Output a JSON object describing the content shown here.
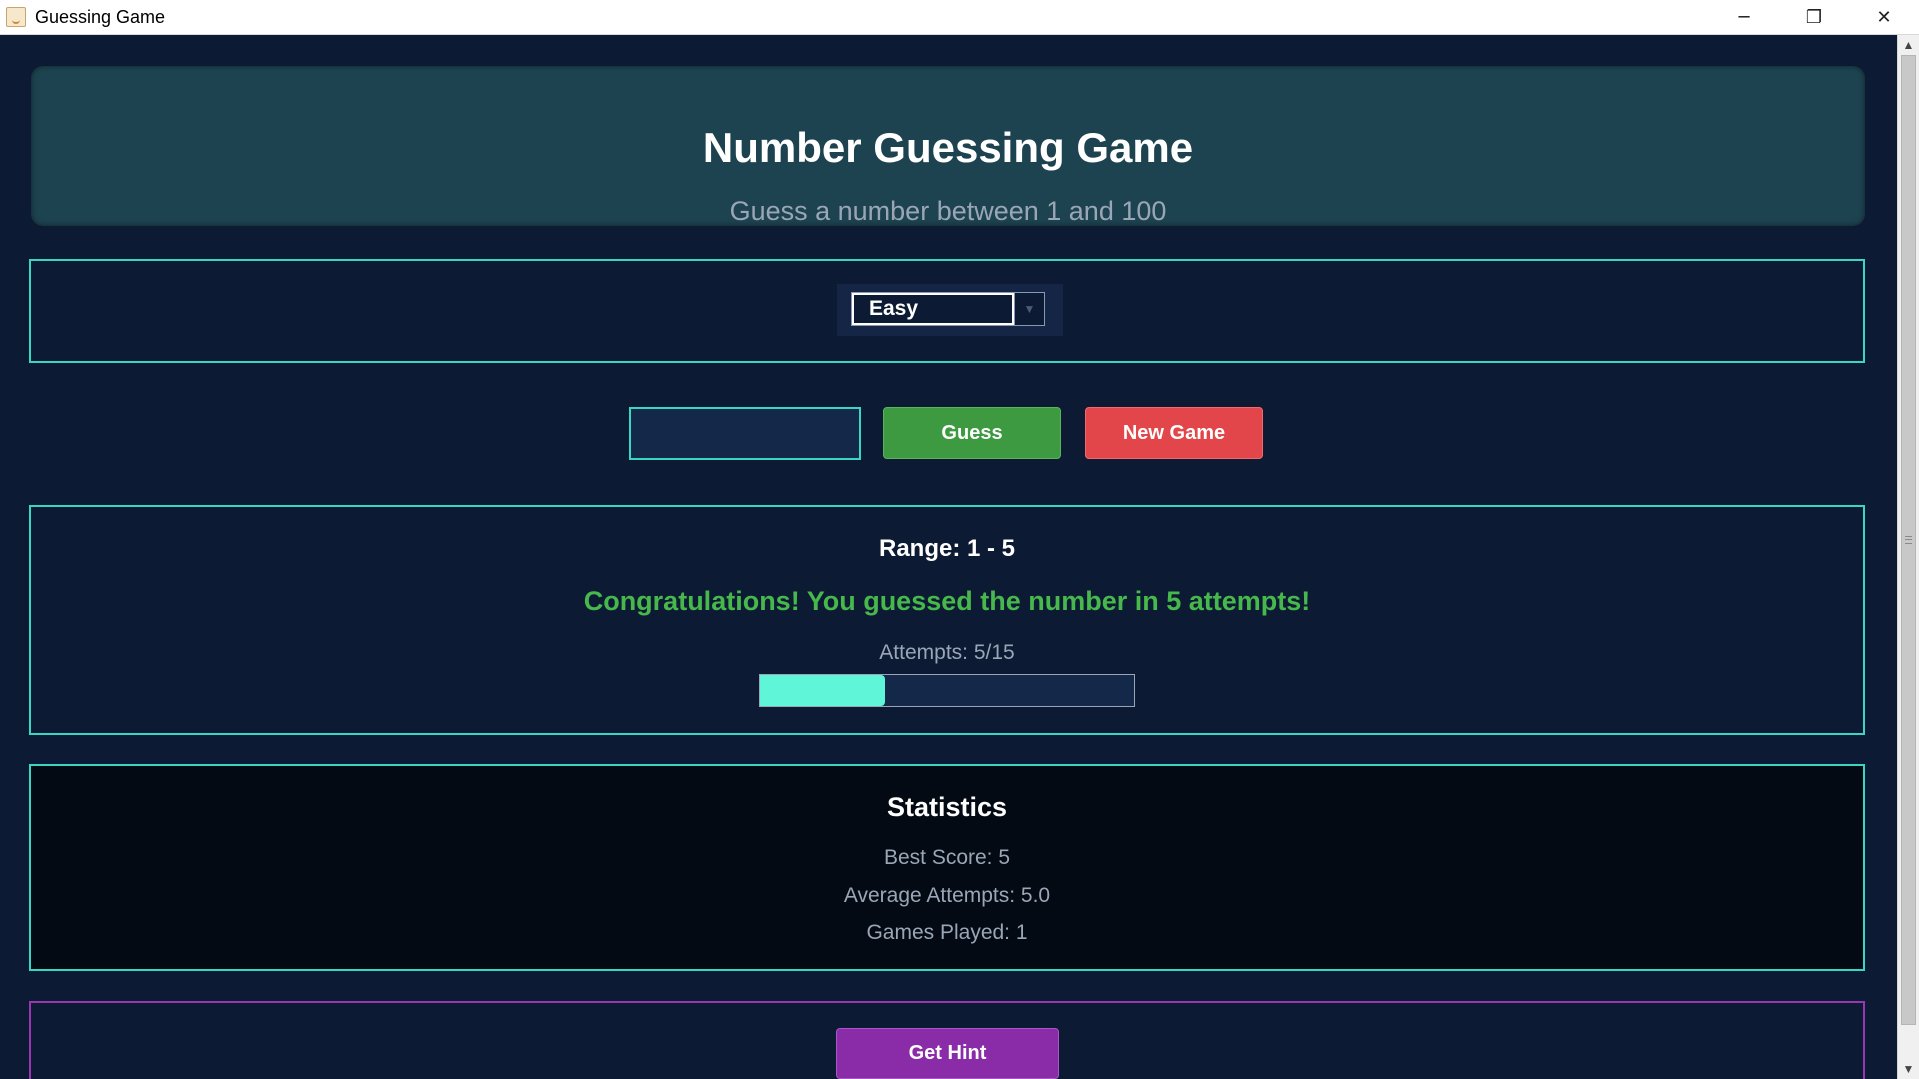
{
  "window": {
    "title": "Guessing Game",
    "minimize_glyph": "─",
    "restore_glyph": "❐",
    "close_glyph": "✕"
  },
  "header": {
    "title": "Number Guessing Game",
    "subtitle": "Guess a number between 1 and 100"
  },
  "difficulty": {
    "selected": "Easy",
    "arrow_glyph": "▼"
  },
  "guess": {
    "input_value": "",
    "guess_label": "Guess",
    "new_game_label": "New Game"
  },
  "status": {
    "range_text": "Range: 1 - 5",
    "message": "Congratulations! You guessed the number in 5 attempts!",
    "attempts_text": "Attempts: 5/15",
    "attempts_used": 5,
    "attempts_max": 15
  },
  "stats": {
    "title": "Statistics",
    "best_score": "Best Score: 5",
    "average_attempts": "Average Attempts: 5.0",
    "games_played": "Games Played: 1"
  },
  "hint": {
    "label": "Get Hint"
  },
  "colors": {
    "background": "#0c1a33",
    "accent_teal": "#39d6c4",
    "success_green": "#47b84b",
    "guess_button": "#3d9a41",
    "new_game_button": "#e2464a",
    "hint_button": "#8a2ba8",
    "progress_fill": "#5ff5d9"
  },
  "scrollbar": {
    "up_glyph": "▲",
    "down_glyph": "▼"
  }
}
